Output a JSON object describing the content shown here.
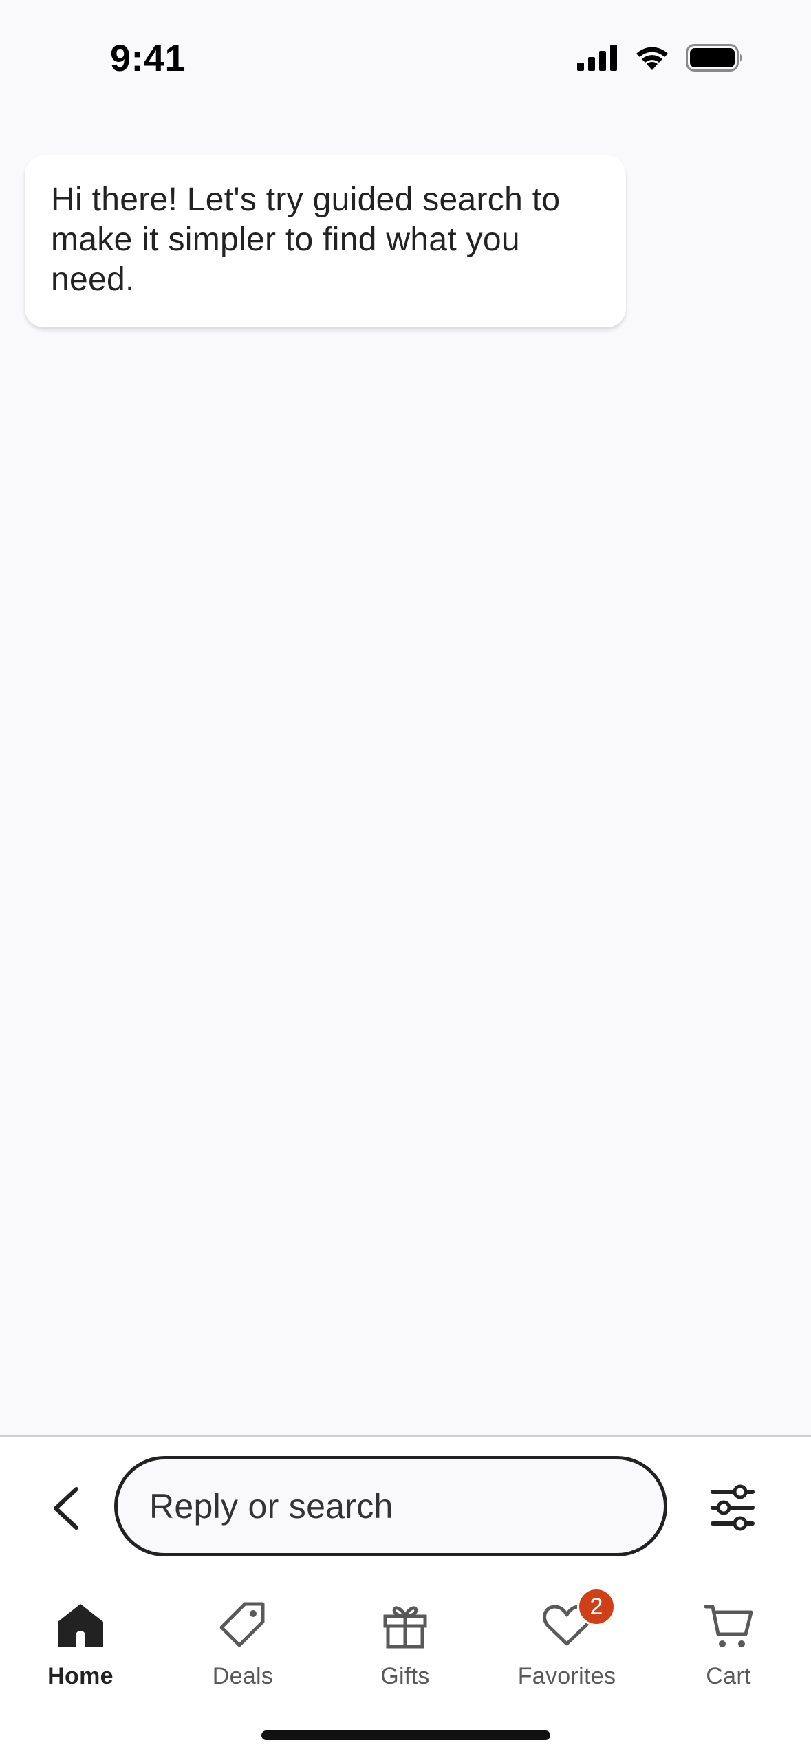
{
  "status_bar": {
    "time": "9:41"
  },
  "chat": {
    "messages": [
      {
        "text": "Hi there! Let's try guided search to make it simpler to find what you need."
      }
    ]
  },
  "reply_bar": {
    "search_placeholder": "Reply or search"
  },
  "tabs": [
    {
      "label": "Home",
      "icon": "home-icon",
      "active": true
    },
    {
      "label": "Deals",
      "icon": "tag-icon"
    },
    {
      "label": "Gifts",
      "icon": "gift-icon"
    },
    {
      "label": "Favorites",
      "icon": "heart-icon",
      "badge": "2"
    },
    {
      "label": "Cart",
      "icon": "cart-icon"
    }
  ],
  "colors": {
    "background": "#f9f9fb",
    "badge": "#cf4018",
    "text": "#222222"
  }
}
